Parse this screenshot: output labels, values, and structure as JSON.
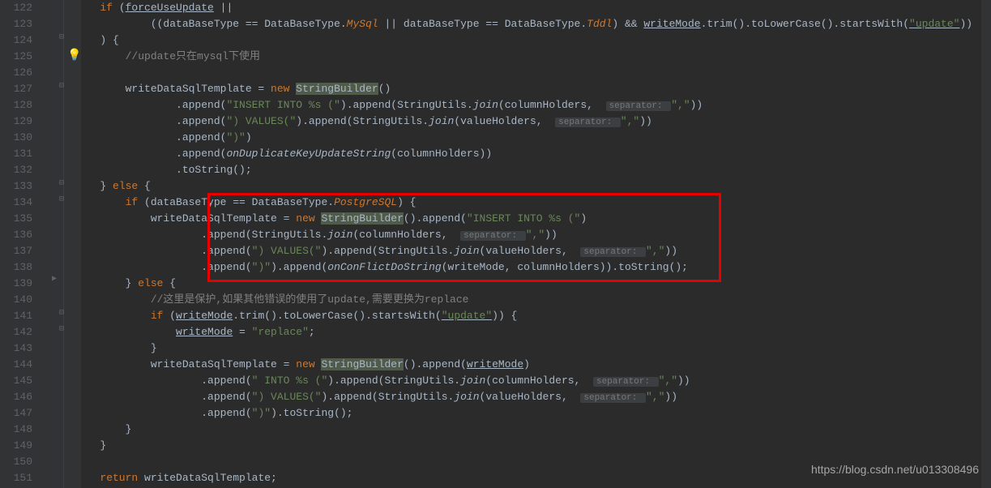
{
  "gutter": {
    "start": 122,
    "end": 151
  },
  "code": {
    "l122_kw1": "if",
    "l122_p1": " (",
    "l122_var1": "forceUseUpdate",
    "l122_p2": " ||",
    "l123_p1": "((dataBaseType == DataBaseType.",
    "l123_mysql": "MySql",
    "l123_p2": " || dataBaseType == DataBaseType.",
    "l123_tddl": "Tddl",
    "l123_p3": ") && ",
    "l123_writemode": "writeMode",
    "l123_p4": ".trim().toLowerCase().startsWith(",
    "l123_str": "\"update\"",
    "l123_p5": "))",
    "l124_p": ") {",
    "l125_comment": "//update只在mysql下使用",
    "l127_p1": "writeDataSqlTemplate = ",
    "l127_new": "new ",
    "l127_sb": "StringBuilder",
    "l127_p2": "()",
    "l128_p1": ".append(",
    "l128_str": "\"INSERT INTO %s (\"",
    "l128_p2": ").append(StringUtils.",
    "l128_join": "join",
    "l128_p3": "(columnHolders, ",
    "l128_hint": "separator: ",
    "l128_str2": "\",\"",
    "l128_p4": "))",
    "l129_p1": ".append(",
    "l129_str": "\") VALUES(\"",
    "l129_p2": ").append(StringUtils.",
    "l129_join": "join",
    "l129_p3": "(valueHolders, ",
    "l129_hint": "separator: ",
    "l129_str2": "\",\"",
    "l129_p4": "))",
    "l130_p1": ".append(",
    "l130_str": "\")\"",
    "l130_p2": ")",
    "l131_p1": ".append(",
    "l131_method": "onDuplicateKeyUpdateString",
    "l131_p2": "(columnHolders))",
    "l132_p": ".toString();",
    "l133_p1": "} ",
    "l133_else": "else",
    "l133_p2": " {",
    "l134_if": "if",
    "l134_p1": " (dataBaseType == DataBaseType.",
    "l134_pg": "PostgreSQL",
    "l134_p2": ") {",
    "l135_p1": "writeDataSqlTemplate = ",
    "l135_new": "new ",
    "l135_sb": "StringBuilder",
    "l135_p2": "().append(",
    "l135_str": "\"INSERT INTO %s (\"",
    "l135_p3": ")",
    "l136_p1": ".append(StringUtils.",
    "l136_join": "join",
    "l136_p2": "(columnHolders, ",
    "l136_hint": "separator: ",
    "l136_str": "\",\"",
    "l136_p3": "))",
    "l137_p1": ".append(",
    "l137_str": "\") VALUES(\"",
    "l137_p2": ").append(StringUtils.",
    "l137_join": "join",
    "l137_p3": "(valueHolders, ",
    "l137_hint": "separator: ",
    "l137_str2": "\",\"",
    "l137_p4": "))",
    "l138_p1": ".append(",
    "l138_str": "\")\"",
    "l138_p2": ").append(",
    "l138_method": "onConFlictDoString",
    "l138_p3": "(writeMode, columnHolders)).toString();",
    "l139_p1": "} ",
    "l139_else": "else",
    "l139_p2": " {",
    "l140_comment": "//这里是保护,如果其他错误的使用了update,需要更换为replace",
    "l141_if": "if",
    "l141_p1": " (",
    "l141_writemode": "writeMode",
    "l141_p2": ".trim().toLowerCase().startsWith(",
    "l141_str": "\"update\"",
    "l141_p3": ")) {",
    "l142_writemode": "writeMode",
    "l142_p1": " = ",
    "l142_str": "\"replace\"",
    "l142_p2": ";",
    "l143_p": "}",
    "l144_p1": "writeDataSqlTemplate = ",
    "l144_new": "new ",
    "l144_sb": "StringBuilder",
    "l144_p2": "().append(",
    "l144_writemode": "writeMode",
    "l144_p3": ")",
    "l145_p1": ".append(",
    "l145_str": "\" INTO %s (\"",
    "l145_p2": ").append(StringUtils.",
    "l145_join": "join",
    "l145_p3": "(columnHolders, ",
    "l145_hint": "separator: ",
    "l145_str2": "\",\"",
    "l145_p4": "))",
    "l146_p1": ".append(",
    "l146_str": "\") VALUES(\"",
    "l146_p2": ").append(StringUtils.",
    "l146_join": "join",
    "l146_p3": "(valueHolders, ",
    "l146_hint": "separator: ",
    "l146_str2": "\",\"",
    "l146_p4": "))",
    "l147_p1": ".append(",
    "l147_str": "\")\"",
    "l147_p2": ").toString();",
    "l148_p": "}",
    "l149_p": "}",
    "l151_return": "return",
    "l151_p": " writeDataSqlTemplate;"
  },
  "watermark": "https://blog.csdn.net/u013308496"
}
